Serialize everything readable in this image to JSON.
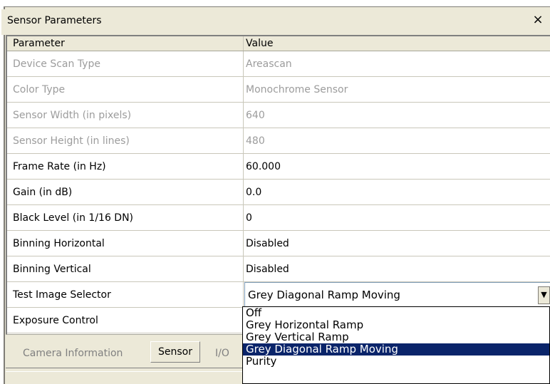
{
  "window": {
    "title": "Sensor Parameters",
    "close_glyph": "×"
  },
  "grid": {
    "header": {
      "parameter": "Parameter",
      "value": "Value"
    },
    "rows": [
      {
        "parameter": "Device Scan Type",
        "value": "Areascan",
        "readonly": true
      },
      {
        "parameter": "Color Type",
        "value": "Monochrome Sensor",
        "readonly": true
      },
      {
        "parameter": "Sensor Width (in pixels)",
        "value": "640",
        "readonly": true
      },
      {
        "parameter": "Sensor Height (in lines)",
        "value": "480",
        "readonly": true
      },
      {
        "parameter": "Frame Rate (in Hz)",
        "value": "60.000",
        "readonly": false
      },
      {
        "parameter": "Gain (in dB)",
        "value": "0.0",
        "readonly": false
      },
      {
        "parameter": "Black Level (in 1/16 DN)",
        "value": "0",
        "readonly": false
      },
      {
        "parameter": "Binning Horizontal",
        "value": "Disabled",
        "readonly": false
      },
      {
        "parameter": "Binning Vertical",
        "value": "Disabled",
        "readonly": false
      },
      {
        "parameter": "Test Image Selector",
        "value": "Grey Diagonal Ramp Moving",
        "readonly": false
      },
      {
        "parameter": "Exposure Control",
        "value": "",
        "readonly": false
      }
    ]
  },
  "dropdown": {
    "arrow_glyph": "▼",
    "options": [
      "Off",
      "Grey Horizontal Ramp",
      "Grey Vertical Ramp",
      "Grey Diagonal Ramp Moving",
      "Purity"
    ],
    "selected": "Grey Diagonal Ramp Moving"
  },
  "tabs": [
    "Camera Information",
    "Sensor",
    "I/O"
  ],
  "active_tab": "Sensor",
  "colors": {
    "selection": "#0a246a",
    "readonly_text": "#9c9c9c",
    "panel": "#ece9d8"
  }
}
